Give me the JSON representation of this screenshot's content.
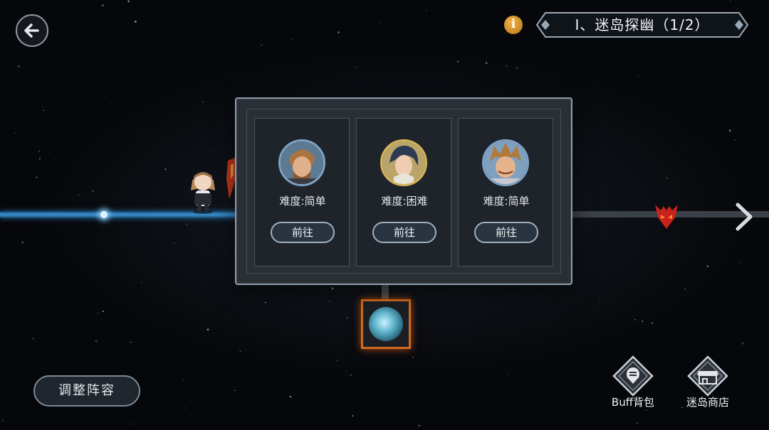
{
  "header": {
    "stage_title": "Ⅰ、迷岛探幽（1/2）"
  },
  "panel": {
    "cards": [
      {
        "difficulty": "难度:简单",
        "go_label": "前往"
      },
      {
        "difficulty": "难度:困难",
        "go_label": "前往"
      },
      {
        "difficulty": "难度:简单",
        "go_label": "前往"
      }
    ]
  },
  "footer": {
    "formation_label": "调整阵容",
    "buff_bag_label": "Buff背包",
    "shop_label": "迷岛商店"
  },
  "colors": {
    "path_active": "#3a8fd0",
    "path_inactive": "#3b4148",
    "tile_border": "#d06a22",
    "info_badge": "#e09a2f"
  }
}
